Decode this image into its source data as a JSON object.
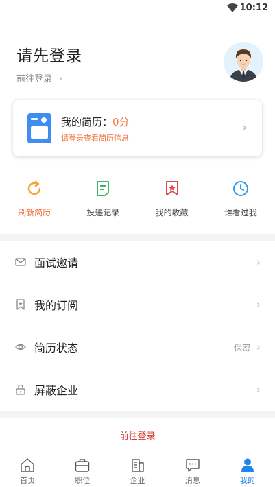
{
  "status_bar": {
    "time": "10:12"
  },
  "header": {
    "title": "请先登录",
    "login_link": "前往登录",
    "chevron": "›"
  },
  "resume": {
    "title": "我的简历：",
    "score": "0分",
    "subtitle": "请登录查看简历信息",
    "chevron": "›"
  },
  "quick_actions": [
    {
      "label": "刷新简历",
      "icon": "refresh-icon"
    },
    {
      "label": "投递记录",
      "icon": "document-icon"
    },
    {
      "label": "我的收藏",
      "icon": "star-bookmark-icon"
    },
    {
      "label": "谁看过我",
      "icon": "clock-icon"
    }
  ],
  "menu": [
    {
      "label": "面试邀请",
      "value": "",
      "icon": "mail-icon"
    },
    {
      "label": "我的订阅",
      "value": "",
      "icon": "bookmark-icon"
    },
    {
      "label": "简历状态",
      "value": "保密",
      "icon": "eye-icon"
    },
    {
      "label": "屏蔽企业",
      "value": "",
      "icon": "lock-icon"
    }
  ],
  "login_button": "前往登录",
  "tabbar": [
    {
      "label": "首页",
      "icon": "home-icon"
    },
    {
      "label": "职位",
      "icon": "briefcase-icon"
    },
    {
      "label": "企业",
      "icon": "building-icon"
    },
    {
      "label": "消息",
      "icon": "message-icon"
    },
    {
      "label": "我的",
      "icon": "person-icon"
    }
  ],
  "colors": {
    "accent_orange": "#f06b3a",
    "accent_blue": "#1e86e8",
    "login_red": "#d63b2e"
  }
}
